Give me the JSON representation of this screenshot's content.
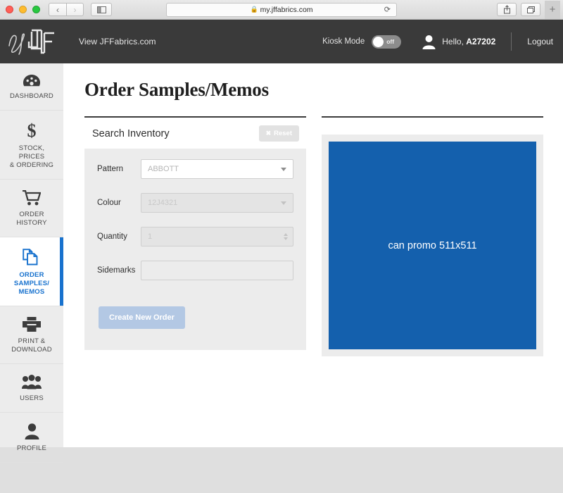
{
  "browser": {
    "url": "my.jffabrics.com",
    "lock_icon": "lock-icon",
    "back_icon": "‹",
    "forward_icon": "›",
    "reload_icon": "⟳",
    "new_tab_label": "+"
  },
  "header": {
    "logo_text": "my JF",
    "view_link": "View JFFabrics.com",
    "kiosk_label": "Kiosk Mode",
    "kiosk_state": "off",
    "greeting_prefix": "Hello, ",
    "user_id": "A27202",
    "logout_label": "Logout"
  },
  "sidebar": {
    "items": [
      {
        "label": "DASHBOARD",
        "icon": "dashboard-gauge-icon",
        "active": false
      },
      {
        "label": "STOCK,\nPRICES\n& ORDERING",
        "icon": "dollar-icon",
        "active": false
      },
      {
        "label": "ORDER\nHISTORY",
        "icon": "shopping-cart-icon",
        "active": false
      },
      {
        "label": "ORDER\nSAMPLES/\nMEMOS",
        "icon": "documents-icon",
        "active": true
      },
      {
        "label": "PRINT &\nDOWNLOAD",
        "icon": "printer-icon",
        "active": false
      },
      {
        "label": "USERS",
        "icon": "users-group-icon",
        "active": false
      },
      {
        "label": "PROFILE",
        "icon": "person-icon",
        "active": false
      }
    ]
  },
  "main": {
    "page_title": "Order Samples/Memos",
    "panel": {
      "title": "Search Inventory",
      "reset_label": "Reset",
      "reset_icon": "✖"
    },
    "fields": [
      {
        "label": "Pattern",
        "value": "ABBOTT",
        "state": "enabled",
        "control": "select"
      },
      {
        "label": "Colour",
        "value": "12J4321",
        "state": "disabled",
        "control": "select"
      },
      {
        "label": "Quantity",
        "value": "1",
        "state": "disabled",
        "control": "number"
      },
      {
        "label": "Sidemarks",
        "value": "",
        "state": "blank",
        "control": "text"
      }
    ],
    "create_button": "Create New Order",
    "promo_image_text": "can promo 511x511"
  },
  "colors": {
    "accent_blue": "#1872ce",
    "promo_blue": "#1460ad",
    "header_dark": "#3a3a3a",
    "panel_grey": "#ececec",
    "button_blue": "#b3c8e4"
  }
}
